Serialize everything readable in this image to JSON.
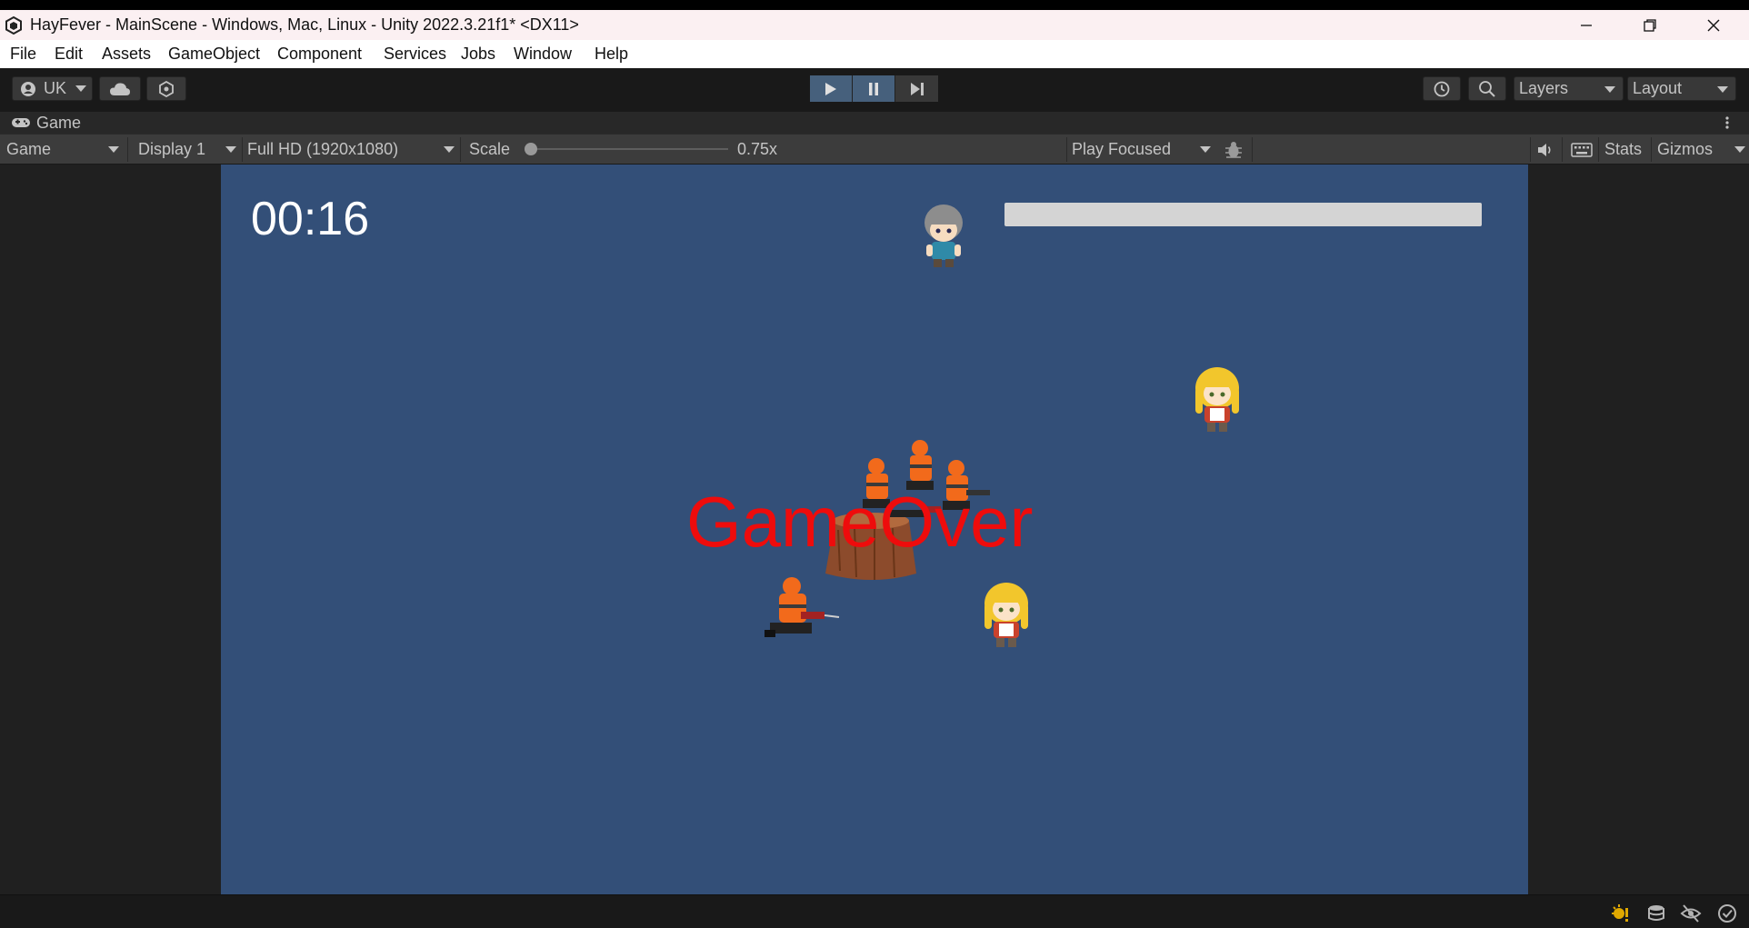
{
  "window": {
    "title": "HayFever - MainScene - Windows, Mac, Linux - Unity 2022.3.21f1* <DX11>"
  },
  "menu": [
    "File",
    "Edit",
    "Assets",
    "GameObject",
    "Component",
    "Services",
    "Jobs",
    "Window",
    "Help"
  ],
  "toolbar": {
    "account_label": "UK",
    "layers_label": "Layers",
    "layout_label": "Layout",
    "play_state": "playing"
  },
  "tab": {
    "label": "Game"
  },
  "game_toolbar": {
    "view_mode": "Game",
    "display": "Display 1",
    "resolution": "Full HD (1920x1080)",
    "scale_label": "Scale",
    "scale_value": "0.75x",
    "play_mode": "Play Focused",
    "stats_label": "Stats",
    "gizmos_label": "Gizmos"
  },
  "game": {
    "timer": "00:16",
    "game_over_text": "GameOver",
    "background_color": "#334f78",
    "game_over_color": "#ee0c0c"
  },
  "icons": [
    "unity-logo-icon",
    "minimize-icon",
    "restore-icon",
    "close-icon",
    "account-icon",
    "cloud-icon",
    "collab-icon",
    "play-icon",
    "pause-icon",
    "step-icon",
    "history-icon",
    "search-icon",
    "gamepad-icon",
    "kebab-icon",
    "bug-icon",
    "audio-icon",
    "keyboard-icon",
    "lighting-icon",
    "cache-icon",
    "visibility-icon",
    "check-icon"
  ]
}
